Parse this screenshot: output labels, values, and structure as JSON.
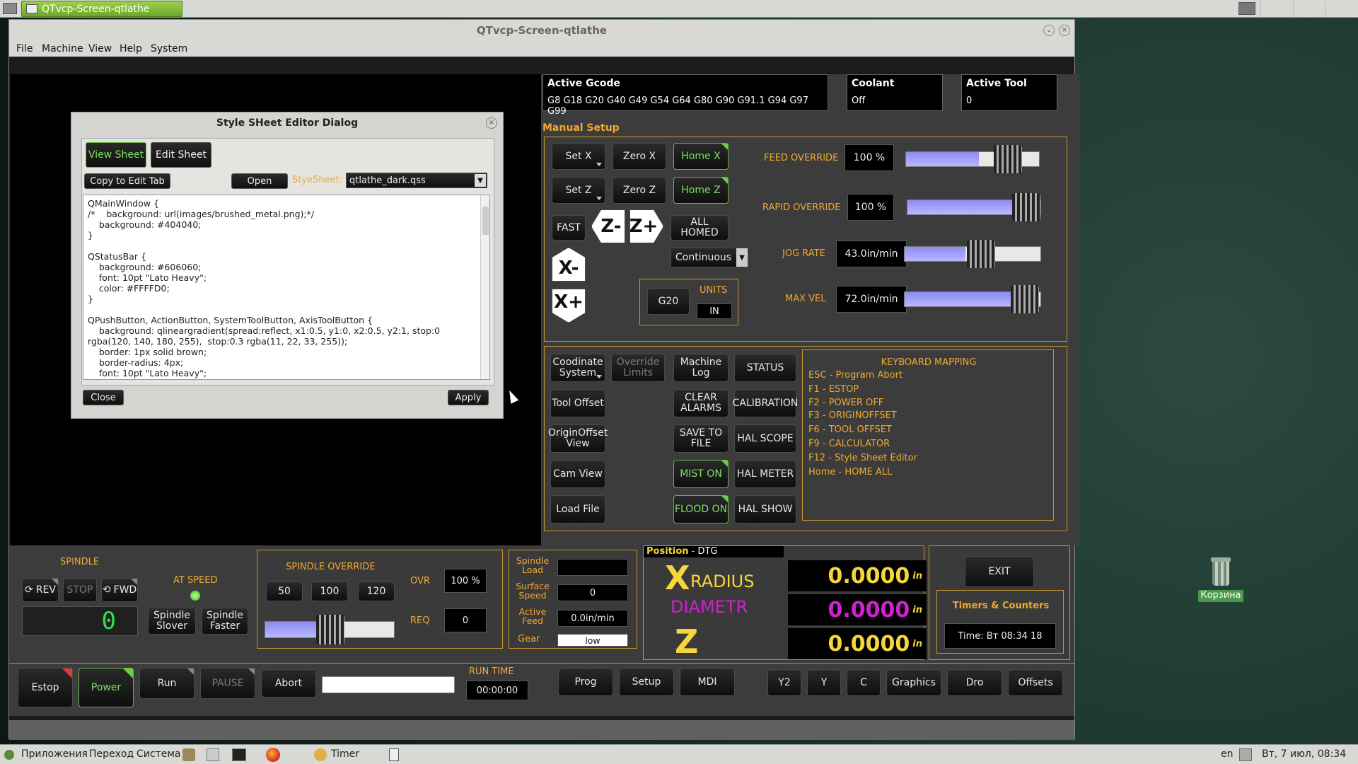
{
  "taskbar_top": {
    "task_title": "QTvcp-Screen-qtlathe"
  },
  "window": {
    "title": "QTvcp-Screen-qtlathe",
    "menu": [
      "File",
      "Machine",
      "View",
      "Help",
      "System"
    ]
  },
  "active_gcode": {
    "label": "Active Gcode",
    "value": "G8 G18 G20 G40 G49 G54 G64 G80 G90 G91.1 G94 G97 G99"
  },
  "coolant": {
    "label": "Coolant",
    "value": "Off"
  },
  "active_tool": {
    "label": "Active Tool",
    "value": "0"
  },
  "manual_setup": {
    "label": "Manual Setup",
    "set_x": "Set X",
    "zero_x": "Zero X",
    "home_x": "Home X",
    "set_z": "Set Z",
    "zero_z": "Zero Z",
    "home_z": "Home Z",
    "fast": "FAST",
    "z_minus": "Z-",
    "z_plus": "Z+",
    "all_homed": "ALL HOMED",
    "x_minus": "X-",
    "x_plus": "X+",
    "jog_mode": "Continuous",
    "g20": "G20",
    "units_label": "UNITS",
    "units_value": "IN"
  },
  "overrides": {
    "feed_label": "FEED OVERRIDE",
    "feed_value": "100 %",
    "feed_level": 0.5,
    "rapid_label": "RAPID OVERRIDE",
    "rapid_value": "100 %",
    "rapid_level": 1.0,
    "jog_label": "JOG RATE",
    "jog_value": "43.0in/min",
    "jog_level": 0.43,
    "maxvel_label": "MAX VEL",
    "maxvel_value": "72.0in/min",
    "maxvel_level": 1.0
  },
  "buttons": {
    "coord_system": "Coodinate System",
    "override_limits": "Override Limits",
    "machine_log": "Machine Log",
    "status": "STATUS",
    "tool_offset": "Tool Offset",
    "clear_alarms": "CLEAR ALARMS",
    "calibration": "CALIBRATION",
    "origin_offset_view": "OriginOffset View",
    "save_to_file": "SAVE TO FILE",
    "hal_scope": "HAL SCOPE",
    "cam_view": "Cam View",
    "mist_on": "MIST ON",
    "hal_meter": "HAL METER",
    "load_file": "Load File",
    "flood_on": "FLOOD ON",
    "hal_show": "HAL SHOW"
  },
  "keyboard_mapping": {
    "title": "KEYBOARD MAPPING",
    "lines": [
      "ESC - Program Abort",
      "F1 - ESTOP",
      "F2 - POWER OFF",
      "F3 - ORIGINOFFSET",
      "F6 - TOOL OFFSET",
      "F9 - CALCULATOR",
      "F12 - Style Sheet Editor",
      "Home - HOME ALL"
    ]
  },
  "dialog": {
    "title": "Style SHeet Editor Dialog",
    "tab_view": "View Sheet",
    "tab_edit": "Edit Sheet",
    "copy_btn": "Copy to Edit Tab",
    "open_btn": "Open",
    "stylesheet_label": "StyeSheet:",
    "stylesheet_value": "qtlathe_dark.qss",
    "code": "QMainWindow {\n/*    background: url(images/brushed_metal.png);*/\n    background: #404040;\n}\n\nQStatusBar {\n    background: #606060;\n    font: 10pt \"Lato Heavy\";\n    color: #FFFFD0;\n}\n\nQPushButton, ActionButton, SystemToolButton, AxisToolButton {\n    background: qlineargradient(spread:reflect, x1:0.5, y1:0, x2:0.5, y2:1, stop:0\nrgba(120, 140, 180, 255),  stop:0.3 rgba(11, 22, 33, 255));\n    border: 1px solid brown;\n    border-radius: 4px;\n    font: 10pt \"Lato Heavy\";",
    "close_btn": "Close",
    "apply_btn": "Apply"
  },
  "spindle": {
    "label": "SPINDLE",
    "rev": "REV",
    "stop": "STOP",
    "fwd": "FWD",
    "at_speed": "AT SPEED",
    "slower": "Spindle Slover",
    "faster": "Spindle Faster",
    "display": "0"
  },
  "spindle_override": {
    "label": "SPINDLE OVERRIDE",
    "p50": "50",
    "p100": "100",
    "p120": "120",
    "ovr_label": "OVR",
    "ovr_value": "100 %",
    "req_label": "REQ",
    "req_value": "0",
    "level": 0.5
  },
  "spindle_info": {
    "load_label": "Spindle Load",
    "surface_label": "Surface Speed",
    "surface_value": "0",
    "feed_label": "Active Feed",
    "feed_value": "0.0in/min",
    "gear_label": "Gear",
    "gear_value": "low"
  },
  "position": {
    "title": "Position",
    "subtitle": "DTG",
    "x_letter": "X",
    "x_mode": "RADIUS",
    "x_mode2": "DIAMETR",
    "z_letter": "Z",
    "val1": "0.0000",
    "val2": "0.0000",
    "val3": "0.0000",
    "unit": "in"
  },
  "exit": {
    "label": "EXIT"
  },
  "timers": {
    "title": "Timers & Counters",
    "time": "Time:  Вт 08:34 18"
  },
  "bottom_buttons": {
    "estop": "Estop",
    "power": "Power",
    "run": "Run",
    "pause": "PAUSE",
    "abort": "Abort",
    "run_time_label": "RUN TIME",
    "run_time": "00:00:00",
    "prog": "Prog",
    "setup": "Setup",
    "mdi": "MDI",
    "y2": "Y2",
    "y": "Y",
    "c": "C",
    "graphics": "Graphics",
    "dro": "Dro",
    "offsets": "Offsets"
  },
  "desktop": {
    "trash_label": "Корзина"
  },
  "taskbar_bottom": {
    "apps": "Приложения",
    "go": "Переход",
    "system": "Система",
    "timer": "Timer",
    "lang": "en",
    "clock": "Вт, 7 июл, 08:34"
  },
  "colors": {
    "orange": "#f0a830",
    "green": "#7fe060",
    "dro_yellow": "#f6d63a",
    "magenta": "#d020d0"
  }
}
